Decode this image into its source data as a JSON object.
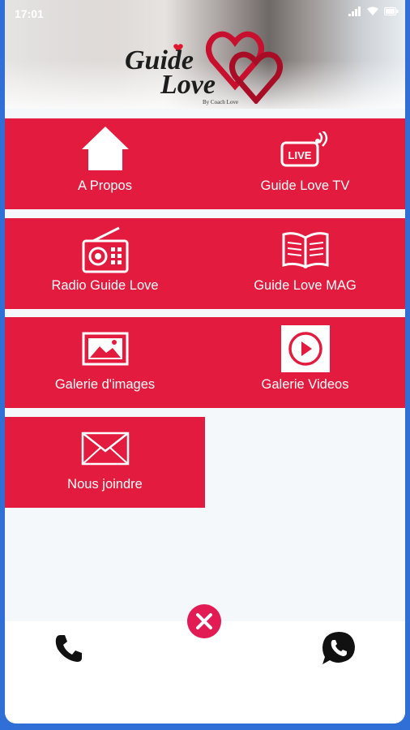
{
  "status_bar": {
    "time": "17:01"
  },
  "header": {
    "logo_line1": "Guide",
    "logo_line2": "Love",
    "logo_byline": "By Coach Love"
  },
  "menu": [
    {
      "label": "A Propos",
      "icon": "home-icon"
    },
    {
      "label": "Guide Love TV",
      "icon": "live-tv-icon"
    },
    {
      "label": "Radio Guide Love",
      "icon": "radio-icon"
    },
    {
      "label": "Guide Love MAG",
      "icon": "open-book-icon"
    },
    {
      "label": "Galerie d'images",
      "icon": "image-icon"
    },
    {
      "label": "Galerie Videos",
      "icon": "play-video-icon"
    },
    {
      "label": "Nous joindre",
      "icon": "envelope-icon"
    }
  ],
  "live_badge": "LIVE",
  "colors": {
    "tile": "#e31b3e",
    "close": "#e31b55",
    "frame": "#2f6fd6"
  },
  "bottom": {
    "phone_icon": "phone-icon",
    "whatsapp_icon": "whatsapp-icon",
    "close_icon": "close-icon"
  }
}
